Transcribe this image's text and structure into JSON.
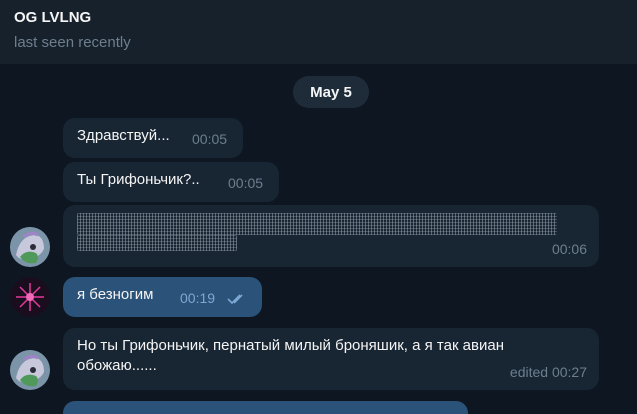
{
  "header": {
    "title": "OG LVLNG",
    "status": "last seen recently"
  },
  "chat": {
    "date": "May 5",
    "messages": [
      {
        "text": "Здравствуй...",
        "time": "00:05",
        "direction": "in"
      },
      {
        "text": "Ты Грифоньчик?..",
        "time": "00:05",
        "direction": "in"
      },
      {
        "text": "",
        "time": "00:06",
        "direction": "in",
        "content": "hidden-spoiler"
      },
      {
        "text": "я безногим",
        "time": "00:19",
        "direction": "out",
        "status": "read"
      },
      {
        "text_line1": "Но ты Грифоньчик, пернатый милый броняшик, а я так авиан",
        "text_line2": "обожаю......",
        "time": "edited 00:27",
        "direction": "in"
      }
    ]
  },
  "colors": {
    "background": "#0e1621",
    "header": "#17212b",
    "incoming_bubble": "#182533",
    "outgoing_bubble": "#2b5278",
    "muted_text": "#6d7f8f"
  }
}
